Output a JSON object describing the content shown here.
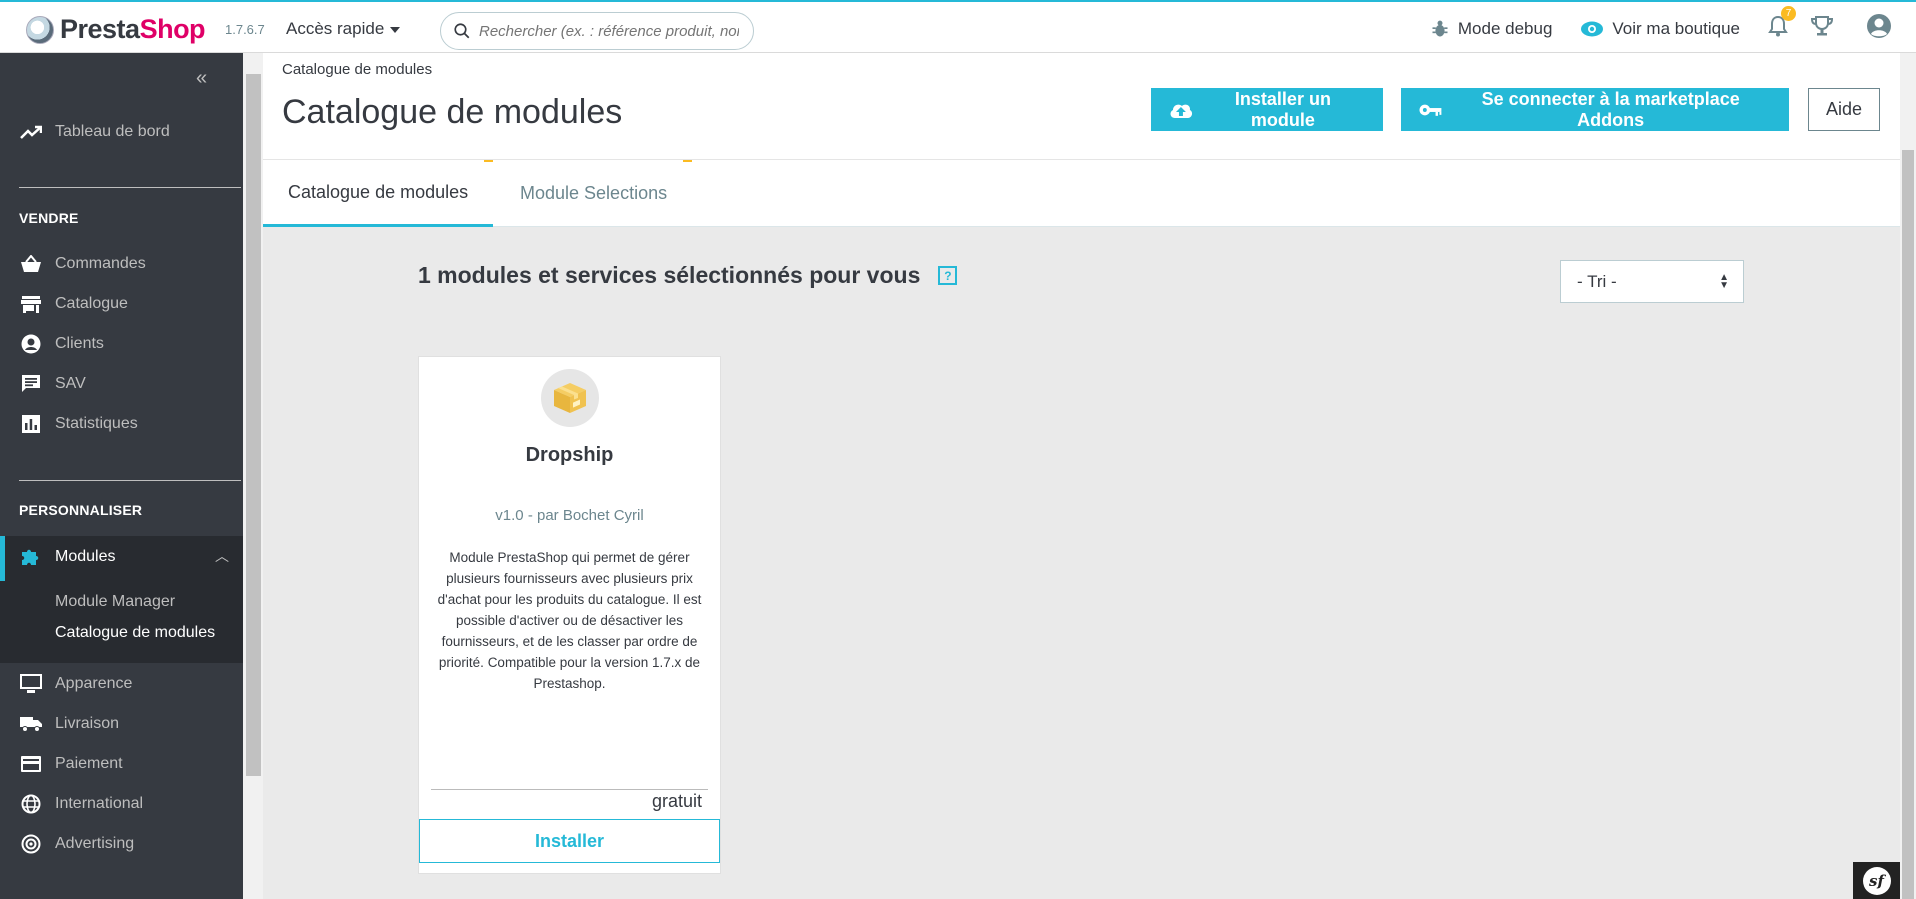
{
  "header": {
    "brand_presta": "Presta",
    "brand_shop": "Shop",
    "version": "1.7.6.7",
    "quick_access": "Accès rapide",
    "search_placeholder": "Rechercher (ex. : référence produit, nom",
    "debug": "Mode debug",
    "view_shop": "Voir ma boutique",
    "notif_count": "7"
  },
  "sidebar": {
    "dashboard": "Tableau de bord",
    "section_sell": "VENDRE",
    "sell_items": [
      "Commandes",
      "Catalogue",
      "Clients",
      "SAV",
      "Statistiques"
    ],
    "section_custom": "PERSONNALISER",
    "modules": "Modules",
    "module_sub": [
      "Module Manager",
      "Catalogue de modules"
    ],
    "custom_items": [
      "Apparence",
      "Livraison",
      "Paiement",
      "International",
      "Advertising"
    ]
  },
  "page": {
    "breadcrumb": "Catalogue de modules",
    "title": "Catalogue de modules",
    "btn_install": "Installer un module",
    "btn_addons": "Se connecter à la marketplace Addons",
    "btn_help": "Aide"
  },
  "tabs": [
    "Catalogue de modules",
    "Module Selections"
  ],
  "content": {
    "count_title": "1 modules et services sélectionnés pour vous",
    "help_mark": "?",
    "sort_label": "- Tri -"
  },
  "module_card": {
    "name": "Dropship",
    "author": "v1.0 - par Bochet Cyril",
    "description": "Module PrestaShop qui permet de gérer plusieurs fournisseurs avec plusieurs prix d'achat pour les produits du catalogue. Il est possible d'activer ou de désactiver les fournisseurs, et de les classer par ordre de priorité. Compatible pour la version 1.7.x de Prestashop.",
    "price": "gratuit",
    "install": "Installer"
  },
  "colors": {
    "accent": "#25b9d7",
    "sidebar_bg": "#363a41",
    "brand_pink": "#df0067",
    "badge": "#fbbb22"
  }
}
